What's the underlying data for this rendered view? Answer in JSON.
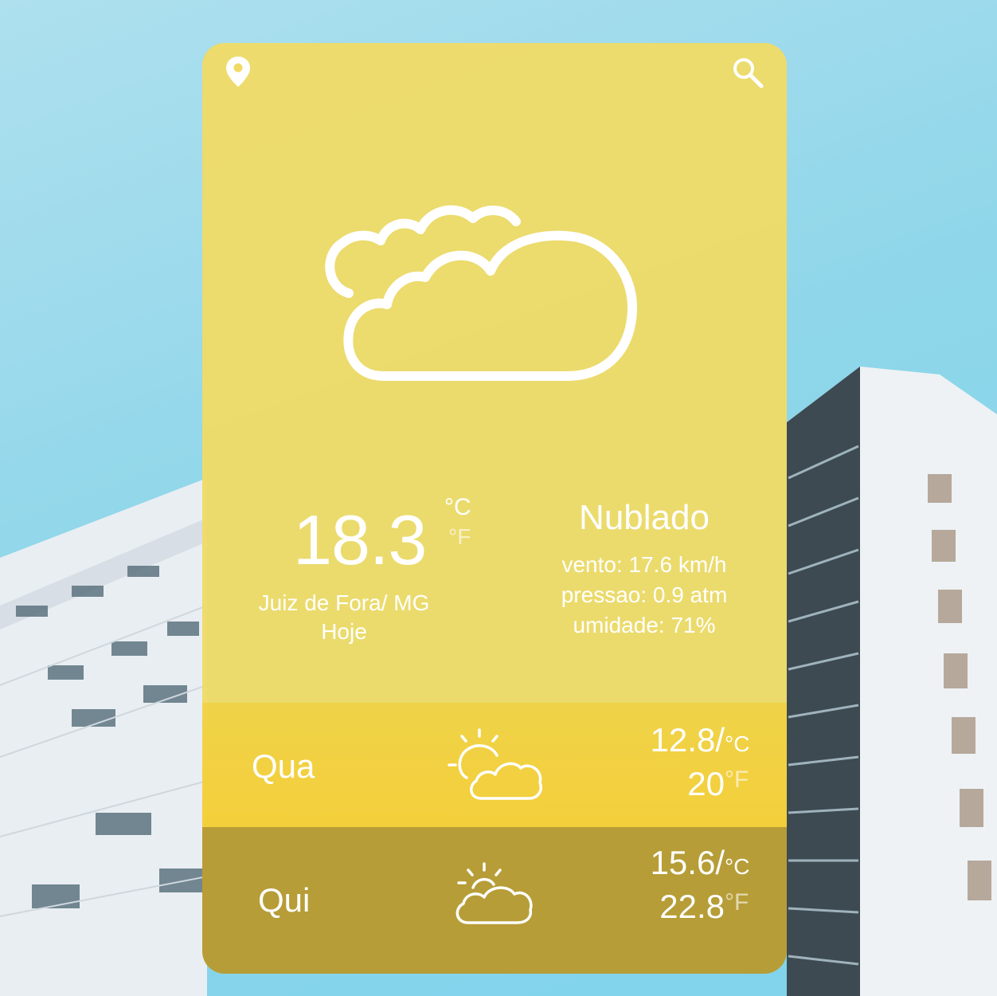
{
  "icons": {
    "location": "map-pin-icon",
    "search": "search-icon",
    "current_weather": "cloudy-icon",
    "forecast_weather": "partly-cloudy-icon"
  },
  "colors": {
    "card": "#f0da64",
    "sky": "#8fd6ea",
    "text": "#ffffff"
  },
  "current": {
    "temperature": "18.3",
    "unit_c": "°C",
    "unit_f": "°F",
    "city": "Juiz de Fora/ MG",
    "day": "Hoje",
    "condition": "Nublado",
    "wind": "vento: 17.6 km/h",
    "pressure": "pressao: 0.9 atm",
    "humidity": "umidade: 71%"
  },
  "forecast": [
    {
      "day": "Qua",
      "temp_c": "12.8",
      "separator": "/",
      "unit_c": "°C",
      "temp_f": "20",
      "unit_f": "°F"
    },
    {
      "day": "Qui",
      "temp_c": "15.6",
      "separator": "/",
      "unit_c": "°C",
      "temp_f": "22.8",
      "unit_f": "°F"
    }
  ]
}
